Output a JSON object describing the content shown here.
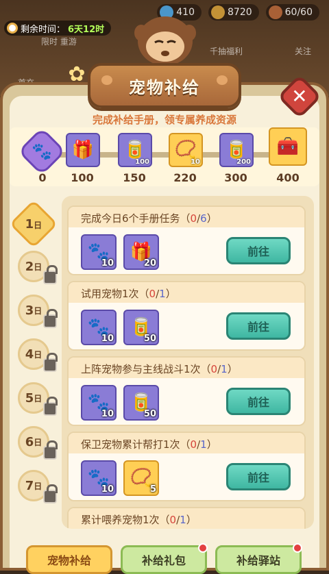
{
  "top_bar": {
    "gem_value": "410",
    "coin_value": "8720",
    "stamina_value": "60/60"
  },
  "timer": {
    "label": "剩余时间：",
    "value": "6天12时"
  },
  "background_buttons": {
    "b1": "限时\n重游",
    "b2": "千抽福利",
    "b3": "关注",
    "b4": "首充"
  },
  "dialog": {
    "title": "宠物补给",
    "subtitle": "完成补给手册，领专属养成资源",
    "close_label": "✕"
  },
  "milestones": [
    {
      "label": "0",
      "count": ""
    },
    {
      "label": "100",
      "count": ""
    },
    {
      "label": "150",
      "count": "100"
    },
    {
      "label": "220",
      "count": "10"
    },
    {
      "label": "300",
      "count": "200"
    },
    {
      "label": "400",
      "count": ""
    }
  ],
  "days": [
    {
      "num": "1",
      "unit": "日",
      "locked": false,
      "active": true
    },
    {
      "num": "2",
      "unit": "日",
      "locked": true
    },
    {
      "num": "3",
      "unit": "日",
      "locked": true
    },
    {
      "num": "4",
      "unit": "日",
      "locked": true
    },
    {
      "num": "5",
      "unit": "日",
      "locked": true
    },
    {
      "num": "6",
      "unit": "日",
      "locked": true
    },
    {
      "num": "7",
      "unit": "日",
      "locked": true
    }
  ],
  "tasks": [
    {
      "title": "完成今日6个手册任务（",
      "progress": "0",
      "sep": "/",
      "total": "6",
      "close": "）",
      "rewards": [
        {
          "icon": "paw-badge-icon",
          "count": "10"
        },
        {
          "icon": "gold-chest-icon",
          "count": "20"
        }
      ],
      "button": "前往"
    },
    {
      "title": "试用宠物1次（",
      "progress": "0",
      "sep": "/",
      "total": "1",
      "close": "）",
      "rewards": [
        {
          "icon": "paw-badge-icon",
          "count": "10"
        },
        {
          "icon": "pet-food-icon",
          "count": "50"
        }
      ],
      "button": "前往"
    },
    {
      "title": "上阵宠物参与主线战斗1次（",
      "progress": "0",
      "sep": "/",
      "total": "1",
      "close": "）",
      "rewards": [
        {
          "icon": "paw-badge-icon",
          "count": "10"
        },
        {
          "icon": "pet-food-icon",
          "count": "50"
        }
      ],
      "button": "前往"
    },
    {
      "title": "保卫宠物累计帮打1次（",
      "progress": "0",
      "sep": "/",
      "total": "1",
      "close": "）",
      "rewards": [
        {
          "icon": "paw-badge-icon",
          "count": "10"
        },
        {
          "icon": "pet-collar-icon",
          "count": "5"
        }
      ],
      "button": "前往"
    },
    {
      "title": "累计喂养宠物1次（",
      "progress": "0",
      "sep": "/",
      "total": "1",
      "close": "）"
    }
  ],
  "bottom_tabs": [
    {
      "label": "宠物补给",
      "active": true
    },
    {
      "label": "补给礼包",
      "dot": true
    },
    {
      "label": "补给驿站",
      "dot": true
    }
  ]
}
